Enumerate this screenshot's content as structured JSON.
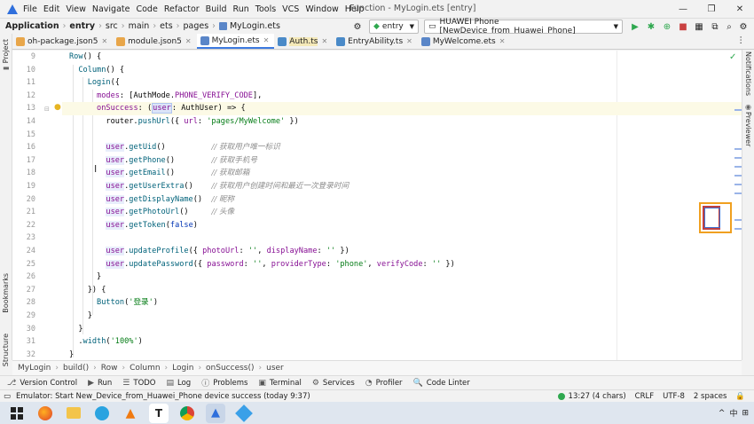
{
  "menubar": {
    "items": [
      "File",
      "Edit",
      "View",
      "Navigate",
      "Code",
      "Refactor",
      "Build",
      "Run",
      "Tools",
      "VCS",
      "Window",
      "Help"
    ],
    "window_title": "Function - MyLogin.ets [entry]",
    "controls": [
      "—",
      "❐",
      "✕"
    ]
  },
  "navbar": {
    "crumbs": [
      "Application",
      "entry",
      "src",
      "main",
      "ets",
      "pages",
      "MyLogin.ets"
    ],
    "module_select": "entry",
    "device_select": "HUAWEI Phone [NewDevice_from_Huawei_Phone]"
  },
  "tabs": [
    {
      "label": "oh-package.json5",
      "color": "#e8a64a",
      "active": false
    },
    {
      "label": "module.json5",
      "color": "#e8a64a",
      "active": false
    },
    {
      "label": "MyLogin.ets",
      "color": "#5a86c8",
      "active": true
    },
    {
      "label": "Auth.ts",
      "color": "#4a8ac8",
      "active": false
    },
    {
      "label": "EntryAbility.ts",
      "color": "#4a8ac8",
      "active": false
    },
    {
      "label": "MyWelcome.ets",
      "color": "#5a86c8",
      "active": false
    }
  ],
  "left_strip": {
    "project": "Project",
    "bookmarks": "Bookmarks",
    "structure": "Structure"
  },
  "right_strip": {
    "notifications": "Notifications",
    "previewer": "Previewer"
  },
  "editor": {
    "line_numbers": [
      "9",
      "10",
      "11",
      "12",
      "13",
      "14",
      "15",
      "16",
      "17",
      "18",
      "19",
      "20",
      "21",
      "22",
      "23",
      "24",
      "25",
      "26",
      "27",
      "28",
      "29",
      "30",
      "31",
      "32"
    ],
    "current_line": 13
  },
  "code_crumb": [
    "MyLogin",
    "build()",
    "Row",
    "Column",
    "Login",
    "onSuccess()",
    "user"
  ],
  "tool_windows": [
    {
      "icon": "⎇",
      "label": "Version Control"
    },
    {
      "icon": "▶",
      "label": "Run"
    },
    {
      "icon": "☰",
      "label": "TODO"
    },
    {
      "icon": "▤",
      "label": "Log"
    },
    {
      "icon": "ⓘ",
      "label": "Problems"
    },
    {
      "icon": "▣",
      "label": "Terminal"
    },
    {
      "icon": "⚙",
      "label": "Services"
    },
    {
      "icon": "◔",
      "label": "Profiler"
    },
    {
      "icon": "🔍",
      "label": "Code Linter"
    }
  ],
  "status": {
    "message": "Emulator: Start New_Device_from_Huawei_Phone device success (today 9:37)",
    "position": "13:27 (4 chars)",
    "line_sep": "CRLF",
    "encoding": "UTF-8",
    "indent": "2 spaces"
  },
  "taskbar": {
    "tray_lang": "中",
    "tray_arrow": "^"
  }
}
